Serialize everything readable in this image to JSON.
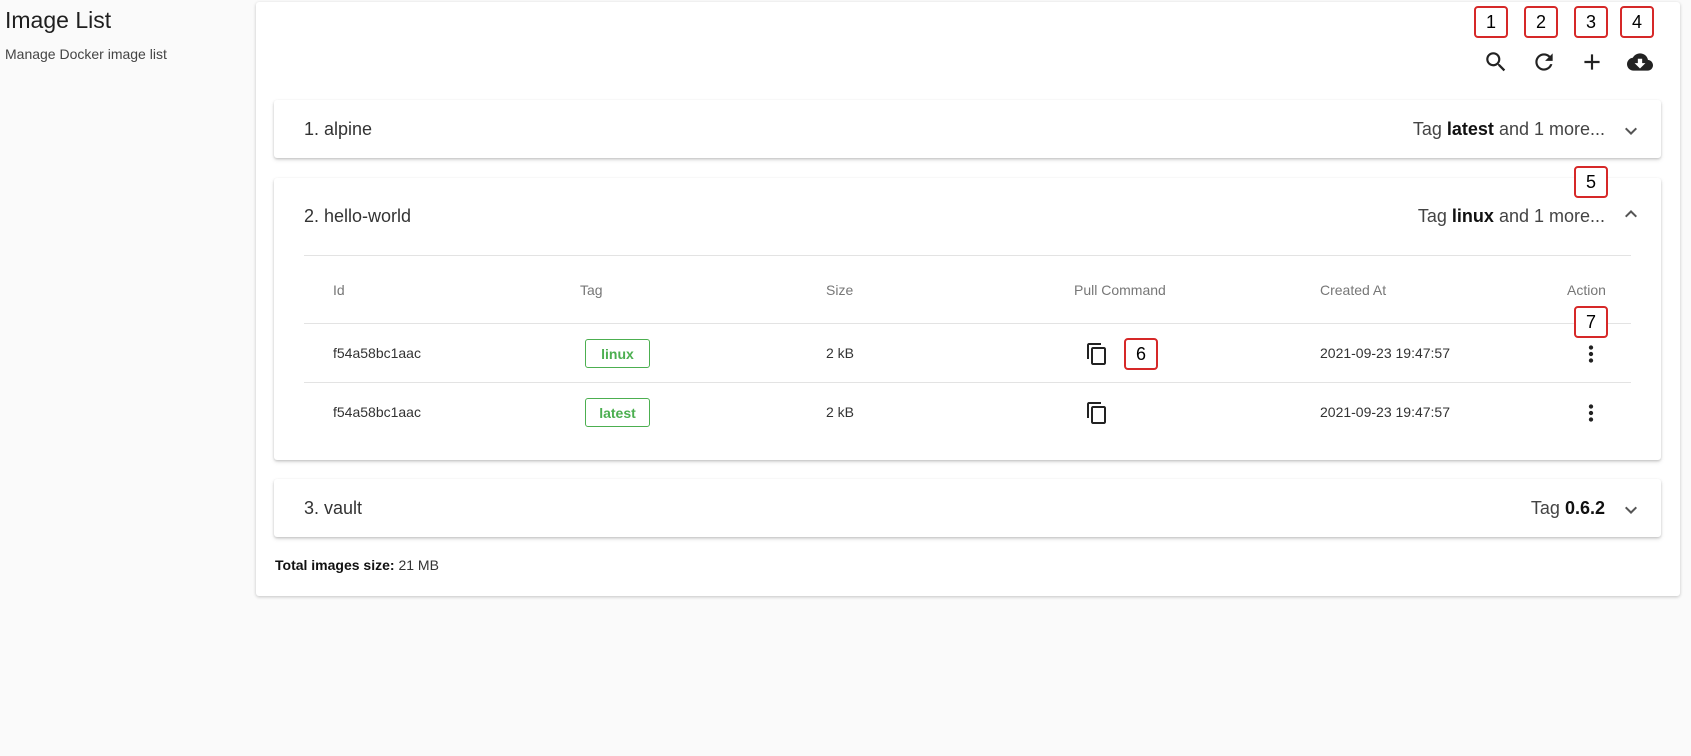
{
  "header": {
    "title": "Image List",
    "subtitle": "Manage Docker image list"
  },
  "toolbar": {
    "search_icon": "search-icon",
    "refresh_icon": "refresh-icon",
    "add_icon": "add-icon",
    "pull_icon": "cloud-download-icon"
  },
  "markers": [
    "1",
    "2",
    "3",
    "4",
    "5",
    "6",
    "7"
  ],
  "images": [
    {
      "title": "1. alpine",
      "summary_prefix": "Tag",
      "summary_tag": "latest",
      "summary_suffix": "and 1 more...",
      "expanded": false
    },
    {
      "title": "2. hello-world",
      "summary_prefix": "Tag",
      "summary_tag": "linux",
      "summary_suffix": "and 1 more...",
      "expanded": true
    },
    {
      "title": "3. vault",
      "summary_prefix": "Tag",
      "summary_tag": "0.6.2",
      "summary_suffix": "",
      "expanded": false
    }
  ],
  "table": {
    "columns": [
      "Id",
      "Tag",
      "Size",
      "Pull Command",
      "Created At",
      "Action"
    ],
    "rows": [
      {
        "id": "f54a58bc1aac",
        "tag": "linux",
        "size": "2 kB",
        "created": "2021-09-23 19:47:57"
      },
      {
        "id": "f54a58bc1aac",
        "tag": "latest",
        "size": "2 kB",
        "created": "2021-09-23 19:47:57"
      }
    ]
  },
  "footer": {
    "label": "Total images size:",
    "value": "21 MB"
  },
  "colors": {
    "accent": "#4caf50",
    "marker_border": "#d62828",
    "background": "#fafafa"
  }
}
